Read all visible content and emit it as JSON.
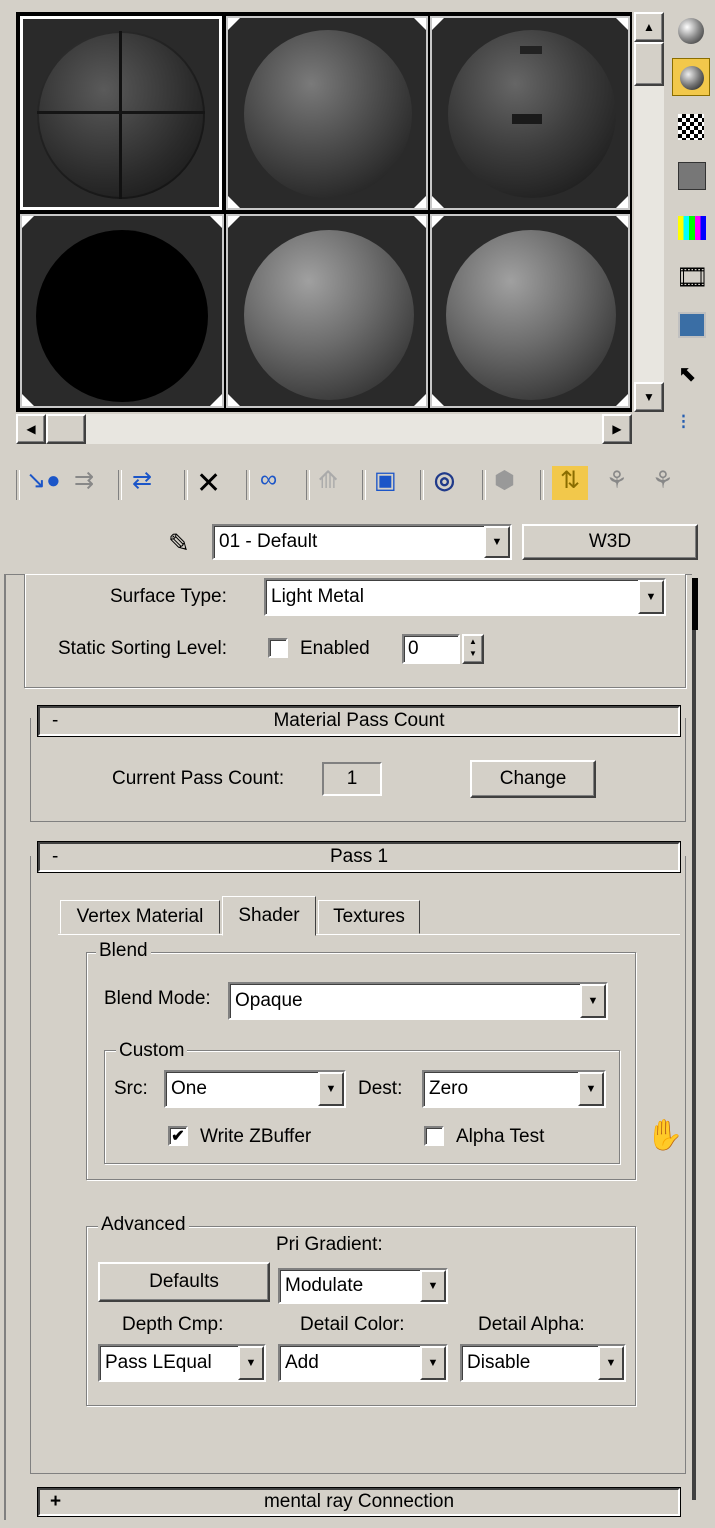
{
  "material_dropdown": {
    "value": "01 - Default"
  },
  "type_button": {
    "label": "W3D"
  },
  "surface": {
    "label": "Surface Type:",
    "value": "Light Metal"
  },
  "static_sorting": {
    "label": "Static Sorting Level:",
    "enabled_label": "Enabled",
    "enabled": false,
    "value": "0"
  },
  "pass_count": {
    "header": "Material Pass Count",
    "label": "Current Pass Count:",
    "value": "1",
    "change_label": "Change"
  },
  "pass1": {
    "header": "Pass 1",
    "tabs": [
      "Vertex Material",
      "Shader",
      "Textures"
    ],
    "active_tab": "Shader",
    "blend": {
      "title": "Blend",
      "mode_label": "Blend Mode:",
      "mode_value": "Opaque",
      "custom": {
        "title": "Custom",
        "src_label": "Src:",
        "src_value": "One",
        "dest_label": "Dest:",
        "dest_value": "Zero",
        "write_zbuffer_label": "Write ZBuffer",
        "write_zbuffer": true,
        "alpha_test_label": "Alpha Test",
        "alpha_test": false
      }
    },
    "advanced": {
      "title": "Advanced",
      "pri_gradient_label": "Pri Gradient:",
      "pri_gradient_value": "Modulate",
      "defaults_label": "Defaults",
      "depth_cmp_label": "Depth Cmp:",
      "depth_cmp_value": "Pass LEqual",
      "detail_color_label": "Detail Color:",
      "detail_color_value": "Add",
      "detail_alpha_label": "Detail Alpha:",
      "detail_alpha_value": "Disable"
    }
  },
  "mental_ray": {
    "header": "mental ray Connection"
  },
  "rollout_signs": {
    "collapse": "-",
    "expand": "+"
  },
  "glyphs": {
    "checkmark": "✔",
    "down_arrow": "▼",
    "up_arrow": "▲",
    "left_arrow": "◀",
    "right_arrow": "▶",
    "spin_up": "▲",
    "spin_down": "▼"
  }
}
